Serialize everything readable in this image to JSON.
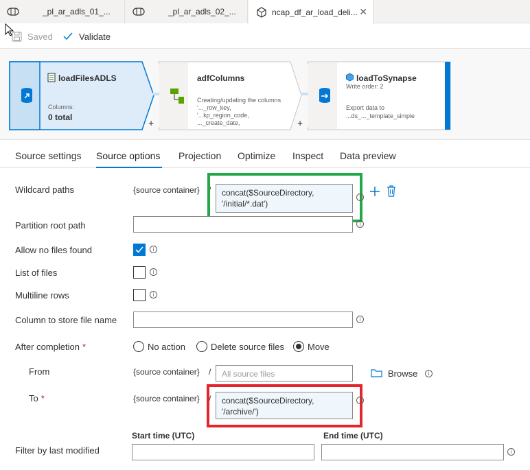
{
  "tabs": [
    {
      "label": "_pl_ar_adls_01_...",
      "icon": "pipeline-icon"
    },
    {
      "label": "_pl_ar_adls_02_...",
      "icon": "pipeline-icon"
    },
    {
      "label": "ncap_df_ar_load_deli...",
      "icon": "dataflow-icon",
      "close": "✕"
    }
  ],
  "toolbar": {
    "saved_label": "Saved",
    "validate_label": "Validate"
  },
  "canvas": {
    "node1": {
      "title": "loadFilesADLS",
      "columns_label": "Columns:",
      "columns_value": "0 total"
    },
    "node2": {
      "title": "adfColumns",
      "desc_lines": [
        "Creating/updating the columns",
        "'..._row_key,",
        "'...kp_region_code,",
        "..._create_date,"
      ]
    },
    "node3": {
      "title": "loadToSynapse",
      "write_order": "Write order: 2",
      "desc_lines": [
        "Export data to",
        "...ds_..._template_simple"
      ]
    },
    "plus": "+"
  },
  "section_tabs": [
    "Source settings",
    "Source options",
    "Projection",
    "Optimize",
    "Inspect",
    "Data preview"
  ],
  "form": {
    "wildcard": {
      "label": "Wildcard paths",
      "container": "{source container}",
      "slash": "/",
      "value_line1": "concat($SourceDirectory,",
      "value_line2": "'/initial/*.dat')"
    },
    "partition": {
      "label": "Partition root path"
    },
    "allow_no_files": {
      "label": "Allow no files found"
    },
    "list_of_files": {
      "label": "List of files"
    },
    "multiline": {
      "label": "Multiline rows"
    },
    "column_file_name": {
      "label": "Column to store file name"
    },
    "after_completion": {
      "label": "After completion",
      "required": "*",
      "options": [
        "No action",
        "Delete source files",
        "Move"
      ],
      "selected": "Move"
    },
    "from": {
      "label": "From",
      "container": "{source container}",
      "slash": "/",
      "placeholder": "All source files",
      "browse": "Browse"
    },
    "to": {
      "label": "To",
      "required": "*",
      "container": "{source container}",
      "slash": "/",
      "value_line1": "concat($SourceDirectory,",
      "value_line2": "'/archive/')"
    },
    "filter": {
      "label": "Filter by last modified",
      "start_label": "Start time (UTC)",
      "end_label": "End time (UTC)"
    }
  },
  "info_glyph": "i",
  "colors": {
    "accent": "#0078d4",
    "green_highlight": "#22a847",
    "red_highlight": "#e3262e"
  }
}
